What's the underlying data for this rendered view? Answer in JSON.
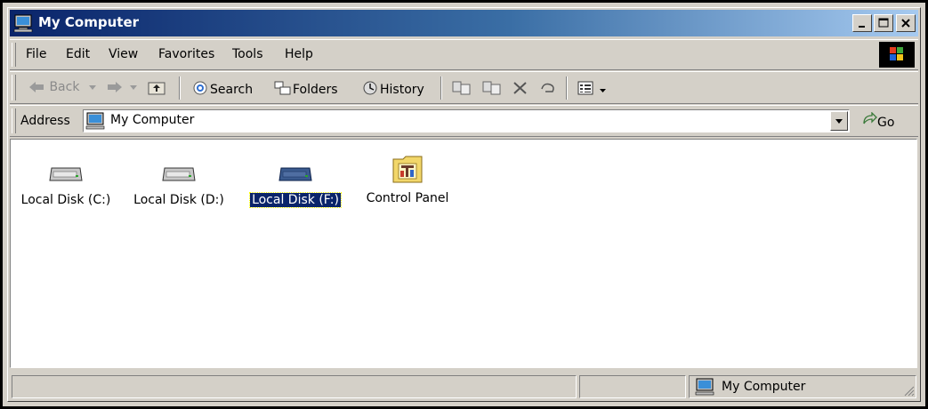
{
  "window": {
    "title": "My Computer",
    "title_icon": "my-computer-icon"
  },
  "menu": {
    "items": [
      "File",
      "Edit",
      "View",
      "Favorites",
      "Tools",
      "Help"
    ]
  },
  "toolbar": {
    "back": "Back",
    "search": "Search",
    "folders": "Folders",
    "history": "History"
  },
  "address": {
    "label": "Address",
    "value": "My Computer",
    "go": "Go"
  },
  "items": [
    {
      "label": "Local Disk (C:)",
      "icon": "hard-drive-icon",
      "selected": false
    },
    {
      "label": "Local Disk (D:)",
      "icon": "hard-drive-icon",
      "selected": false
    },
    {
      "label": "Local Disk (F:)",
      "icon": "hard-drive-icon",
      "selected": true
    },
    {
      "label": "Control Panel",
      "icon": "control-panel-icon",
      "selected": false
    }
  ],
  "status": {
    "location": "My Computer"
  },
  "colors": {
    "titlebar_start": "#0a246a",
    "titlebar_end": "#a6caf0",
    "selection": "#0a246a",
    "chrome": "#d4d0c8"
  }
}
